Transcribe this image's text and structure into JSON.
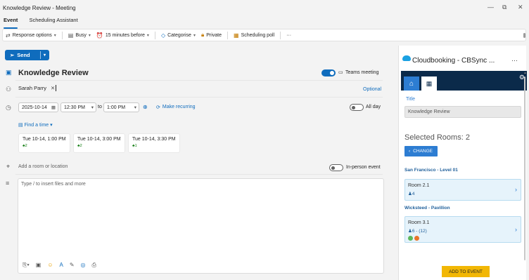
{
  "window": {
    "title": "Knowledge Review - Meeting",
    "controls": [
      "—",
      "⧉",
      "✕"
    ]
  },
  "tabs": [
    {
      "label": "Event",
      "active": true
    },
    {
      "label": "Scheduling Assistant",
      "active": false
    }
  ],
  "ribbon": {
    "response_options": "Response options",
    "busy": "Busy",
    "reminder": "15 minutes before",
    "categorise": "Categorise",
    "private": "Private",
    "scheduling_poll": "Scheduling poll",
    "more": "···"
  },
  "send": {
    "label": "Send"
  },
  "event": {
    "subject": "Knowledge Review",
    "teams_meeting": "Teams meeting",
    "teams_on": true,
    "attendee": "Sarah Parry",
    "optional": "Optional",
    "start_date": "2025-10-14",
    "start_time": "12:30 PM",
    "to": "to",
    "end_time": "1:00 PM",
    "make_recurring": "Make recurring",
    "all_day": "All day",
    "find_a_time": "Find a time",
    "suggestions": [
      {
        "time": "Tue 10-14, 1:00 PM",
        "count": "2"
      },
      {
        "time": "Tue 10-14, 3:00 PM",
        "count": "2"
      },
      {
        "time": "Tue 10-14, 3:30 PM",
        "count": "1"
      }
    ],
    "location_placeholder": "Add a room or location",
    "in_person": "In-person event",
    "body_placeholder": "Type / to insert files and more"
  },
  "addin": {
    "title": "Cloudbooking - CBSync ...",
    "field_label": "Title",
    "field_value": "Knowledge Review",
    "selected_rooms": "Selected Rooms: 2",
    "change": "CHANGE",
    "locations": [
      {
        "name": "San Francisco - Level 01",
        "room": "Room 2.1",
        "capacity": "4"
      },
      {
        "name": "Wicksteed - Pavillion",
        "room": "Room 3.1",
        "capacity": "6 - (12)"
      }
    ],
    "add_to_event": "ADD TO EVENT"
  },
  "colors": {
    "accent": "#0f6cbd",
    "addin_nav": "#0b2a4a",
    "addin_button": "#f2b705"
  }
}
